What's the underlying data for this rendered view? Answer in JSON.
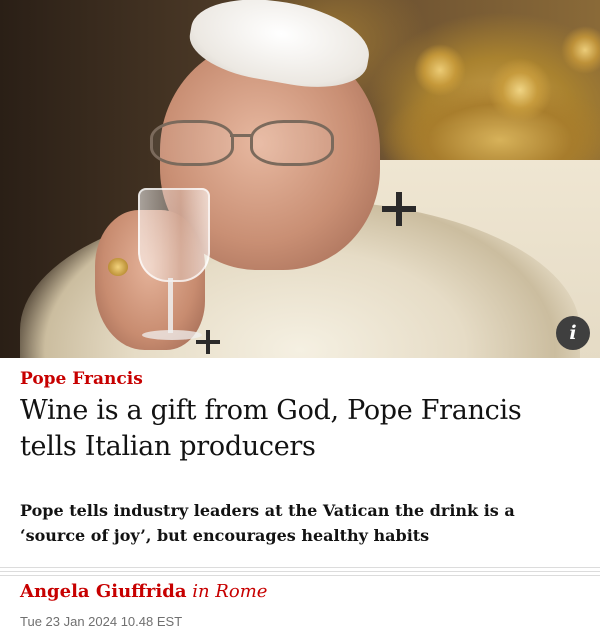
{
  "image": {
    "info_icon": "info-icon",
    "info_symbol": "i"
  },
  "article": {
    "kicker": "Pope Francis",
    "headline": "Wine is a gift from God, Pope Francis tells Italian producers",
    "standfirst": "Pope tells industry leaders at the Vatican the drink is a ‘source of joy’, but encourages healthy habits",
    "byline": {
      "author": "Angela Giuffrida",
      "location": "in Rome"
    },
    "dateline": "Tue 23 Jan 2024 10.48 EST"
  },
  "colors": {
    "accent": "#c70000",
    "text": "#121212",
    "muted": "#707070",
    "divider": "#dcdcdc"
  }
}
